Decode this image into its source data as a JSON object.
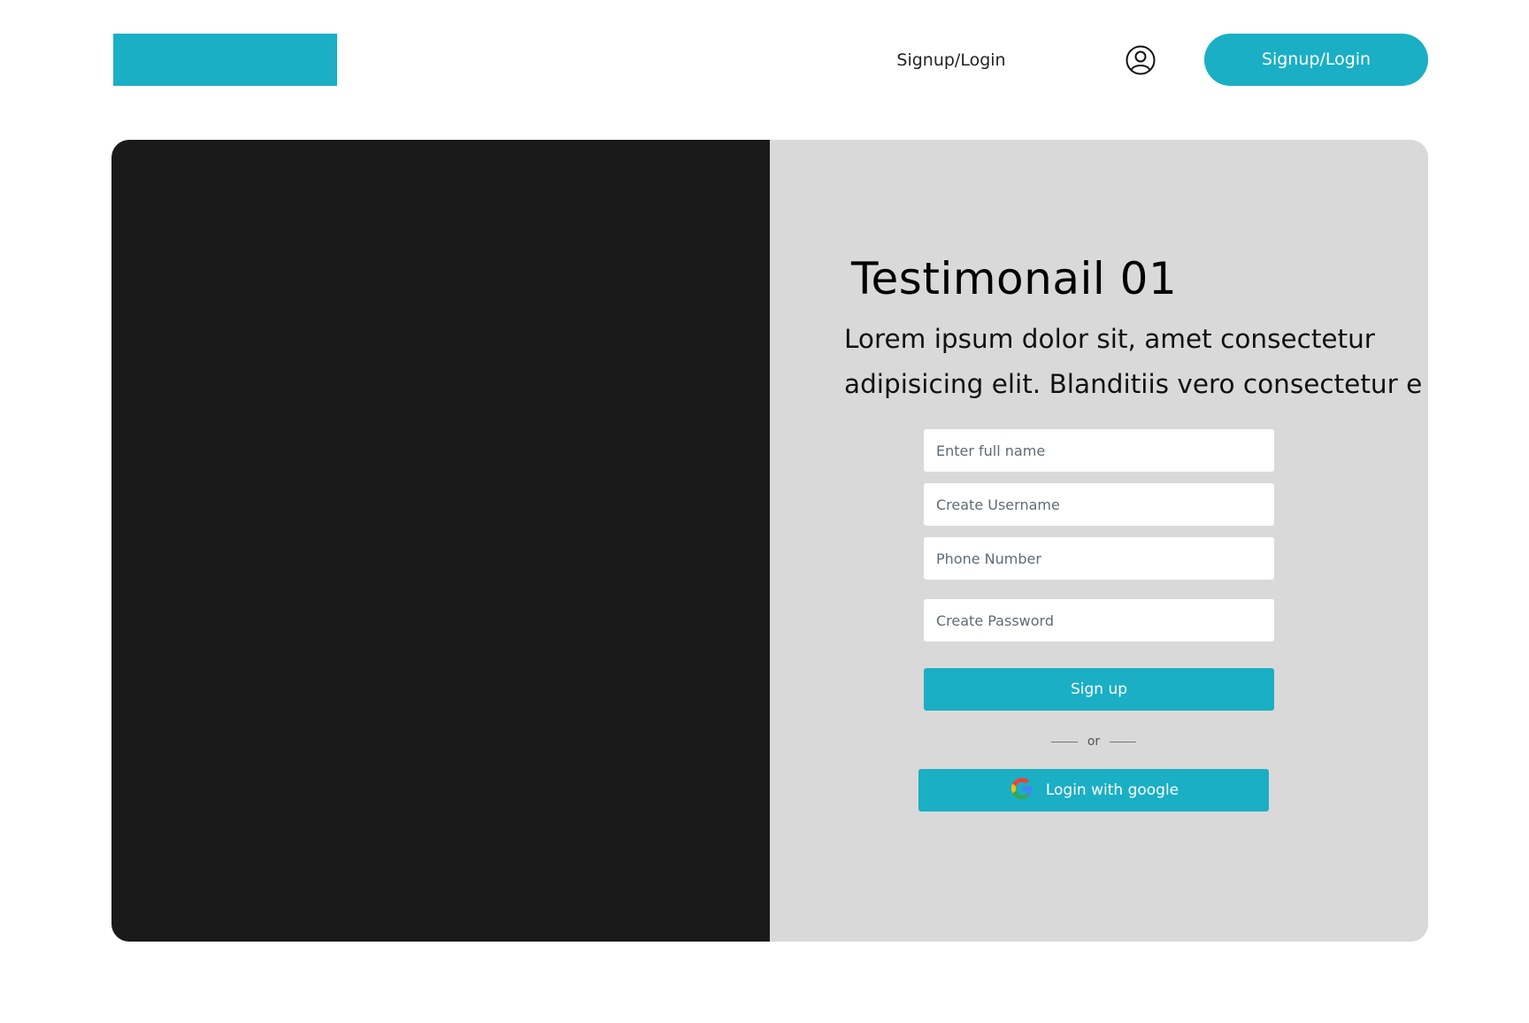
{
  "header": {
    "nav_link_label": "Signup/Login",
    "cta_label": "Signup/Login",
    "user_icon": "user-circle-icon",
    "accent_color": "#1aafc4"
  },
  "card": {
    "media_color": "#1a1a1a",
    "panel_color": "#d9d9d9",
    "title": "Testimonail 01",
    "lead_line_1": "Lorem ipsum dolor sit, amet consectetur",
    "lead_line_2": "adipisicing elit. Blanditiis vero consectetur e"
  },
  "form": {
    "full_name_placeholder": "Enter full name",
    "username_placeholder": "Create Username",
    "phone_placeholder": "Phone Number",
    "password_placeholder": "Create Password",
    "signup_label": "Sign up",
    "divider_text": "or",
    "google_label": "Login with google",
    "google_icon": "google-logo-icon"
  }
}
